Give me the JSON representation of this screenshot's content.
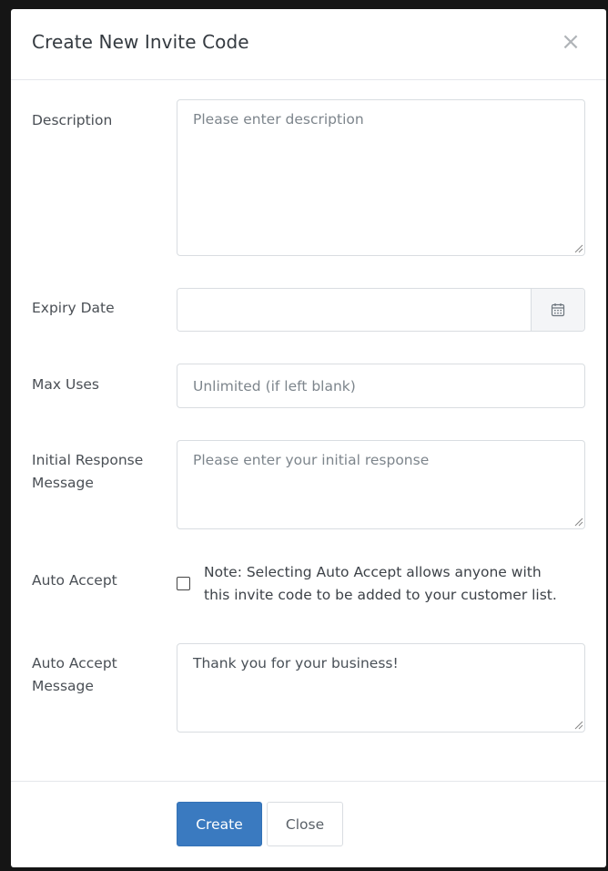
{
  "modal": {
    "title": "Create New Invite Code",
    "close_symbol": "×"
  },
  "form": {
    "description": {
      "label": "Description",
      "value": "",
      "placeholder": "Please enter description"
    },
    "expiry_date": {
      "label": "Expiry Date",
      "value": "",
      "icon": "calendar-icon"
    },
    "max_uses": {
      "label": "Max Uses",
      "value": "",
      "placeholder": "Unlimited (if left blank)"
    },
    "initial_response": {
      "label_line1": "Initial Response",
      "label_line2": "Message",
      "value": "",
      "placeholder": "Please enter your initial response"
    },
    "auto_accept": {
      "label": "Auto Accept",
      "checked": false,
      "note_line1": "Note: Selecting Auto Accept allows anyone with",
      "note_line2": "this invite code to be added to your customer list."
    },
    "auto_accept_message": {
      "label_line1": "Auto Accept",
      "label_line2": "Message",
      "value": "Thank you for your business!"
    }
  },
  "footer": {
    "create_label": "Create",
    "close_label": "Close"
  },
  "colors": {
    "primary": "#3a7ac0",
    "border": "#d9dde1"
  }
}
